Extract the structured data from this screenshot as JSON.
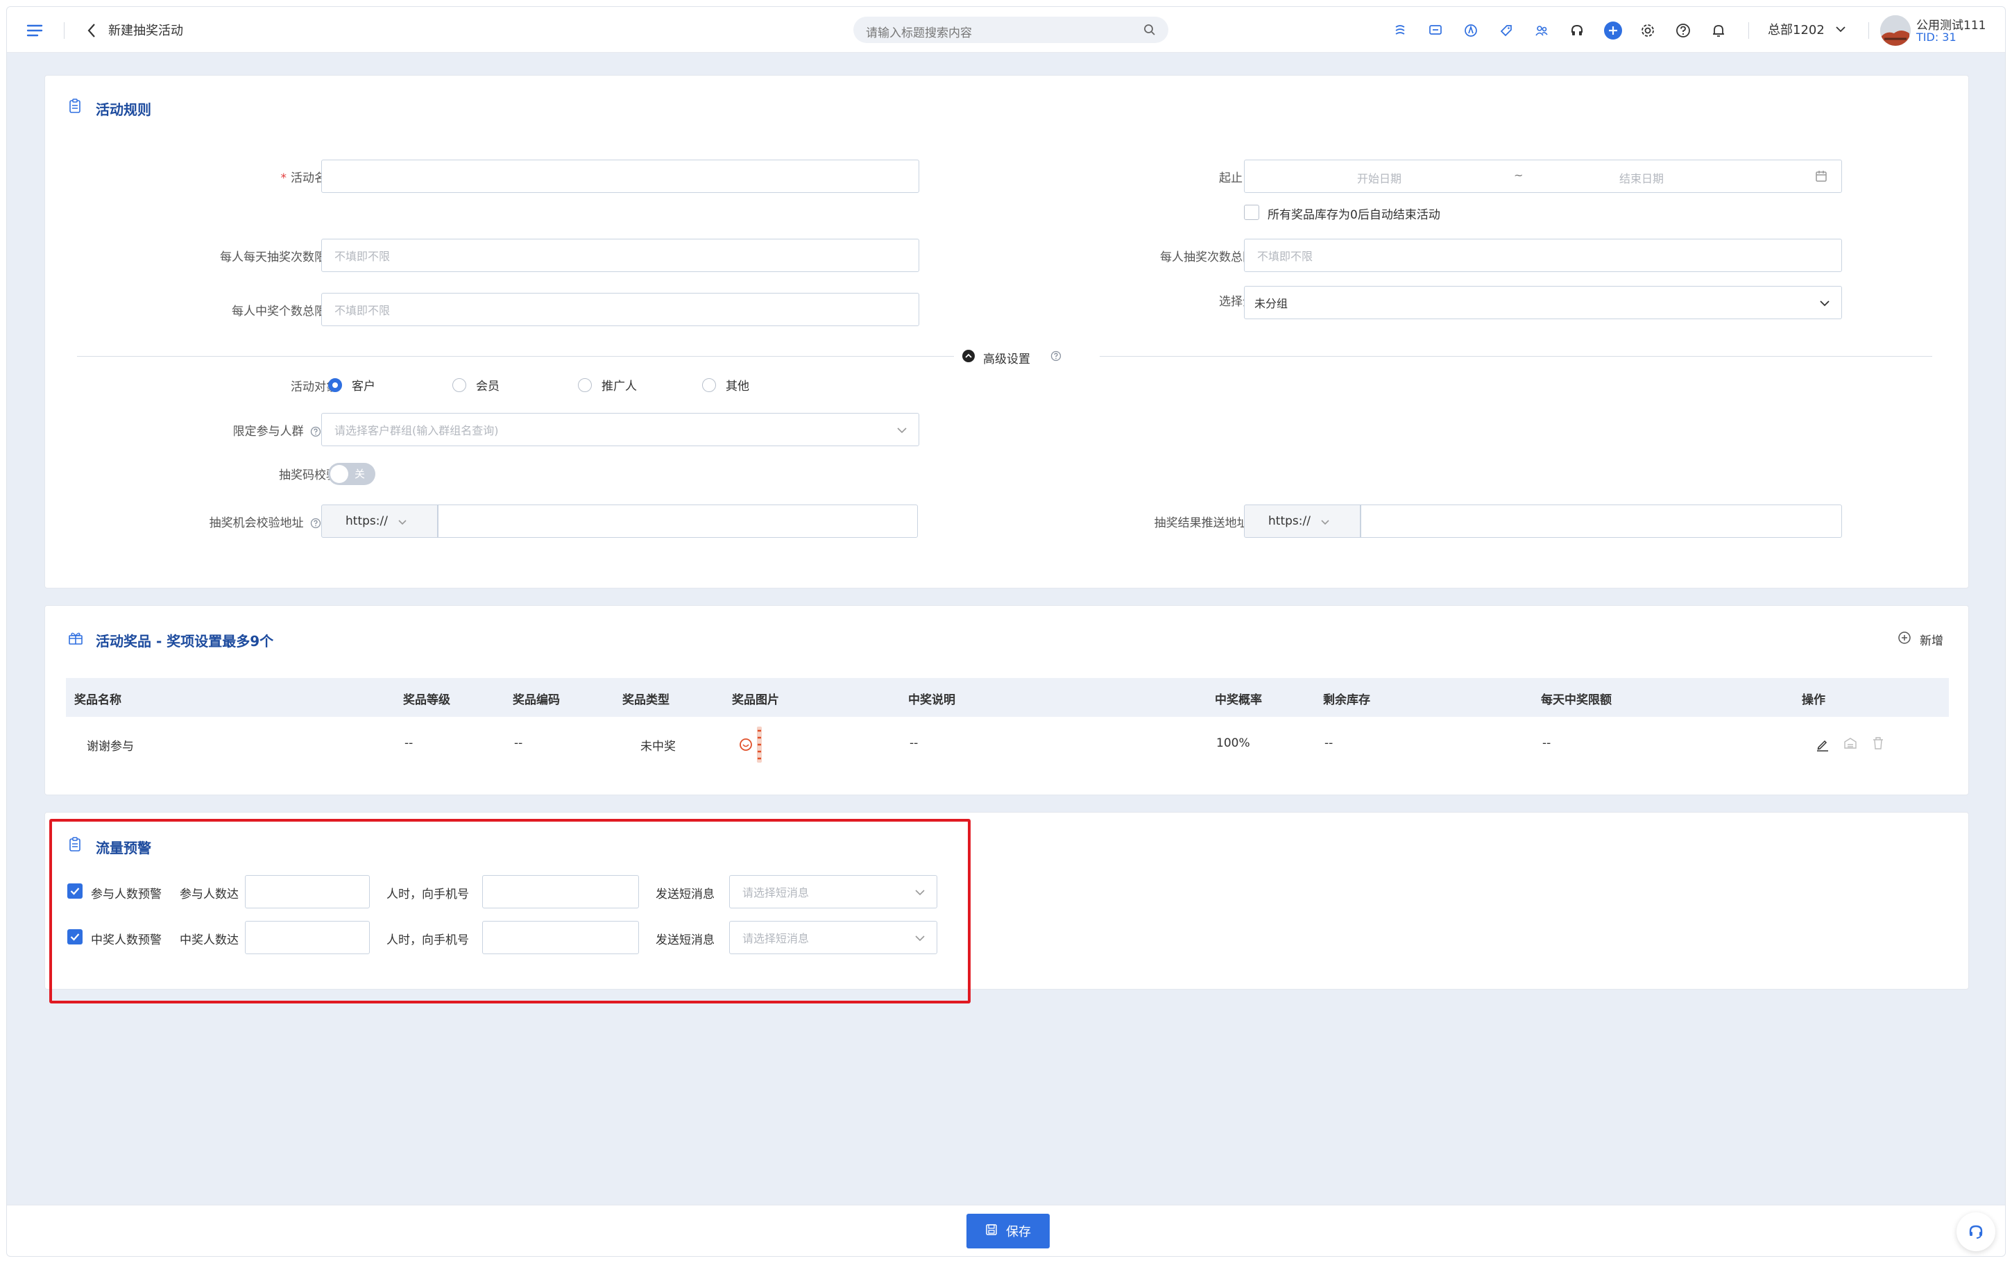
{
  "header": {
    "page_title": "新建抽奖活动",
    "search_placeholder": "请输入标题搜索内容",
    "org_name": "总部1202",
    "user_name": "公用测试111",
    "tid": "TID: 31"
  },
  "rules": {
    "title": "活动规则",
    "name_label": "活动名称",
    "date_label": "起止日期",
    "date_start_placeholder": "开始日期",
    "date_sep": "~",
    "date_end_placeholder": "结束日期",
    "auto_end_label": "所有奖品库存为0后自动结束活动",
    "daily_limit_label": "每人每天抽奖次数限额",
    "daily_limit_placeholder": "不填即不限",
    "total_limit_label": "每人抽奖次数总限额",
    "total_limit_placeholder": "不填即不限",
    "win_limit_label": "每人中奖个数总限额",
    "win_limit_placeholder": "不填即不限",
    "group_label": "选择分组",
    "group_value": "未分组",
    "advanced_label": "高级设置",
    "target_label": "活动对象",
    "target_options": [
      "客户",
      "会员",
      "推广人",
      "其他"
    ],
    "target_selected": "客户",
    "crowd_label": "限定参与人群",
    "crowd_placeholder": "请选择客户群组(输入群组名查询)",
    "code_label": "抽奖码校验",
    "toggle_text": "关",
    "verify_url_label": "抽奖机会校验地址",
    "verify_protocol": "https://",
    "push_url_label": "抽奖结果推送地址",
    "push_protocol": "https://"
  },
  "prizes": {
    "title": "活动奖品 - 奖项设置最多9个",
    "add_label": "新增",
    "columns": [
      "奖品名称",
      "奖品等级",
      "奖品编码",
      "奖品类型",
      "奖品图片",
      "中奖说明",
      "中奖概率",
      "剩余库存",
      "每天中奖限额",
      "操作"
    ],
    "rows": [
      {
        "name": "谢谢参与",
        "level": "--",
        "code": "--",
        "type": "未中奖",
        "desc": "--",
        "rate": "100%",
        "stock": "--",
        "daily": "--"
      }
    ]
  },
  "traffic": {
    "title": "流量预警",
    "rows": [
      {
        "check_label": "参与人数预警",
        "count_label": "参与人数达",
        "mid_label": "人时，向手机号",
        "sms_label": "发送短消息",
        "sms_placeholder": "请选择短消息"
      },
      {
        "check_label": "中奖人数预警",
        "count_label": "中奖人数达",
        "mid_label": "人时，向手机号",
        "sms_label": "发送短消息",
        "sms_placeholder": "请选择短消息"
      }
    ]
  },
  "footer": {
    "save_label": "保存"
  },
  "colors": {
    "primary": "#2f6fe0",
    "title_blue": "#1d4b9e",
    "highlight": "#e01a22",
    "page_bg": "#e9eef6"
  }
}
